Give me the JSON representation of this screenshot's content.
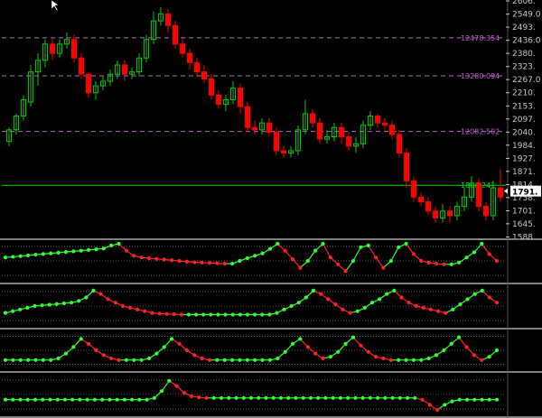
{
  "colors": {
    "background": "#000000",
    "up_candle": "#00cc00",
    "down_candle": "#ff0000",
    "axis_text": "#c8c8c8",
    "panel_border": "#ffffff",
    "level_line": "#c060d0",
    "price_line": "#00dd00",
    "osc_up": "#33ff33",
    "osc_down": "#ff2222",
    "dotted": "#aaaaaa"
  },
  "chart_data": [
    {
      "type": "candlestick",
      "title": "",
      "ylim": [
        1590,
        2610
      ],
      "y_ticks": [
        "2606.",
        "2549.0",
        "2493.",
        "2436.0",
        "2380.",
        "2323.",
        "2267.0",
        "2210.",
        "2153.",
        "2097.",
        "2040.",
        "1984.",
        "1927.",
        "1871.",
        "1814.",
        "1758.",
        "1701.",
        "1645.",
        "1588."
      ],
      "y_tick_values": [
        2606,
        2549,
        2493,
        2436,
        2380,
        2323,
        2267,
        2210,
        2153,
        2097,
        2040,
        1984,
        1927,
        1871,
        1814,
        1758,
        1701,
        1645,
        1588
      ],
      "levels": [
        {
          "value": 2447,
          "label": "12478.354",
          "style": "dash"
        },
        {
          "value": 2283,
          "label": "13280.094",
          "style": "dash"
        },
        {
          "value": 2043,
          "label": "12082.502",
          "style": "dash"
        },
        {
          "value": 1811,
          "label": "1806.241",
          "style": "solid"
        }
      ],
      "current_price": {
        "value": 1786,
        "label": "1791."
      },
      "candles": [
        [
          2000,
          2050,
          1980,
          2060
        ],
        [
          2050,
          2110,
          2030,
          2120
        ],
        [
          2110,
          2180,
          2090,
          2200
        ],
        [
          2170,
          2300,
          2150,
          2330
        ],
        [
          2300,
          2350,
          2240,
          2380
        ],
        [
          2350,
          2420,
          2320,
          2440
        ],
        [
          2420,
          2380,
          2350,
          2450
        ],
        [
          2380,
          2420,
          2360,
          2440
        ],
        [
          2420,
          2440,
          2400,
          2470
        ],
        [
          2440,
          2360,
          2340,
          2460
        ],
        [
          2360,
          2290,
          2270,
          2380
        ],
        [
          2290,
          2210,
          2190,
          2300
        ],
        [
          2210,
          2240,
          2180,
          2260
        ],
        [
          2240,
          2260,
          2220,
          2280
        ],
        [
          2260,
          2290,
          2240,
          2310
        ],
        [
          2290,
          2330,
          2270,
          2350
        ],
        [
          2330,
          2290,
          2260,
          2350
        ],
        [
          2290,
          2300,
          2270,
          2320
        ],
        [
          2300,
          2360,
          2280,
          2380
        ],
        [
          2360,
          2440,
          2340,
          2460
        ],
        [
          2440,
          2520,
          2420,
          2560
        ],
        [
          2520,
          2550,
          2500,
          2580
        ],
        [
          2550,
          2500,
          2470,
          2570
        ],
        [
          2500,
          2420,
          2400,
          2520
        ],
        [
          2420,
          2380,
          2360,
          2440
        ],
        [
          2380,
          2340,
          2310,
          2400
        ],
        [
          2340,
          2300,
          2280,
          2360
        ],
        [
          2300,
          2270,
          2250,
          2330
        ],
        [
          2270,
          2200,
          2180,
          2290
        ],
        [
          2200,
          2160,
          2140,
          2220
        ],
        [
          2160,
          2180,
          2130,
          2200
        ],
        [
          2180,
          2230,
          2160,
          2260
        ],
        [
          2230,
          2150,
          2120,
          2250
        ],
        [
          2150,
          2060,
          2040,
          2170
        ],
        [
          2060,
          2050,
          2030,
          2090
        ],
        [
          2050,
          2080,
          2030,
          2100
        ],
        [
          2080,
          2040,
          2020,
          2100
        ],
        [
          2040,
          1960,
          1940,
          2060
        ],
        [
          1960,
          1950,
          1930,
          1980
        ],
        [
          1950,
          1960,
          1930,
          1980
        ],
        [
          1960,
          2050,
          1940,
          2070
        ],
        [
          2050,
          2120,
          2030,
          2180
        ],
        [
          2120,
          2080,
          2060,
          2140
        ],
        [
          2080,
          2010,
          1990,
          2100
        ],
        [
          2010,
          2020,
          1990,
          2050
        ],
        [
          2020,
          2060,
          2000,
          2080
        ],
        [
          2060,
          2020,
          1990,
          2080
        ],
        [
          2020,
          1980,
          1960,
          2040
        ],
        [
          1980,
          1990,
          1950,
          2020
        ],
        [
          1990,
          2070,
          1970,
          2090
        ],
        [
          2070,
          2110,
          2050,
          2130
        ],
        [
          2110,
          2080,
          2060,
          2120
        ],
        [
          2080,
          2070,
          2050,
          2100
        ],
        [
          2070,
          2030,
          2010,
          2090
        ],
        [
          2030,
          1950,
          1930,
          2050
        ],
        [
          1950,
          1830,
          1800,
          1970
        ],
        [
          1830,
          1760,
          1740,
          1850
        ],
        [
          1760,
          1740,
          1720,
          1780
        ],
        [
          1740,
          1700,
          1680,
          1760
        ],
        [
          1700,
          1670,
          1650,
          1720
        ],
        [
          1670,
          1700,
          1650,
          1730
        ],
        [
          1700,
          1680,
          1650,
          1720
        ],
        [
          1680,
          1720,
          1660,
          1740
        ],
        [
          1720,
          1760,
          1700,
          1800
        ],
        [
          1760,
          1820,
          1740,
          1850
        ],
        [
          1820,
          1720,
          1700,
          1840
        ],
        [
          1720,
          1680,
          1660,
          1740
        ],
        [
          1680,
          1800,
          1660,
          1830
        ],
        [
          1800,
          1760,
          1740,
          1880
        ]
      ]
    },
    {
      "type": "line",
      "title": "",
      "series": [
        {
          "values": [
            0.6,
            0.62,
            0.64,
            0.66,
            0.68,
            0.7,
            0.72,
            0.74,
            0.76,
            0.78,
            0.8,
            0.82,
            0.84,
            0.86,
            0.95,
            1.0,
            0.8,
            0.65,
            0.6,
            0.58,
            0.56,
            0.54,
            0.52,
            0.5,
            0.48,
            0.46,
            0.45,
            0.44,
            0.43,
            0.42,
            0.42,
            0.5,
            0.58,
            0.65,
            0.72,
            0.85,
            1.0,
            0.8,
            0.55,
            0.3,
            0.5,
            0.8,
            1.0,
            0.6,
            0.4,
            0.2,
            0.5,
            0.9,
            0.95,
            0.6,
            0.3,
            0.5,
            0.9,
            1.0,
            0.7,
            0.5,
            0.45,
            0.42,
            0.4,
            0.4,
            0.45,
            0.6,
            0.75,
            1.0,
            0.7,
            0.5
          ],
          "colors": "trend"
        }
      ],
      "ylim": [
        0,
        1
      ]
    },
    {
      "type": "line",
      "title": "",
      "series": [
        {
          "values": [
            0.3,
            0.35,
            0.4,
            0.45,
            0.5,
            0.52,
            0.54,
            0.56,
            0.58,
            0.6,
            0.65,
            0.75,
            0.95,
            0.85,
            0.7,
            0.6,
            0.5,
            0.45,
            0.4,
            0.35,
            0.3,
            0.28,
            0.27,
            0.26,
            0.25,
            0.25,
            0.25,
            0.25,
            0.25,
            0.25,
            0.25,
            0.25,
            0.25,
            0.25,
            0.25,
            0.25,
            0.25,
            0.3,
            0.4,
            0.5,
            0.6,
            0.75,
            0.95,
            0.85,
            0.7,
            0.55,
            0.4,
            0.3,
            0.35,
            0.45,
            0.6,
            0.7,
            0.85,
            0.95,
            0.75,
            0.6,
            0.5,
            0.45,
            0.4,
            0.35,
            0.3,
            0.4,
            0.55,
            0.7,
            0.85,
            0.95,
            0.75,
            0.6
          ],
          "colors": "trend"
        }
      ],
      "ylim": [
        0,
        1
      ]
    },
    {
      "type": "line",
      "title": "",
      "series": [
        {
          "values": [
            0.2,
            0.2,
            0.2,
            0.2,
            0.2,
            0.2,
            0.2,
            0.25,
            0.4,
            0.6,
            0.85,
            0.7,
            0.5,
            0.35,
            0.25,
            0.2,
            0.2,
            0.2,
            0.2,
            0.25,
            0.4,
            0.6,
            0.85,
            0.7,
            0.5,
            0.35,
            0.25,
            0.2,
            0.2,
            0.2,
            0.2,
            0.2,
            0.2,
            0.2,
            0.2,
            0.2,
            0.25,
            0.45,
            0.7,
            0.85,
            0.6,
            0.4,
            0.25,
            0.3,
            0.45,
            0.7,
            0.9,
            0.65,
            0.45,
            0.3,
            0.25,
            0.2,
            0.2,
            0.2,
            0.2,
            0.2,
            0.25,
            0.35,
            0.5,
            0.7,
            0.9,
            0.6,
            0.35,
            0.2,
            0.3,
            0.5
          ],
          "colors": "trend"
        }
      ],
      "ylim": [
        0,
        1
      ]
    },
    {
      "type": "line",
      "title": "",
      "series": [
        {
          "values": [
            0.35,
            0.35,
            0.35,
            0.35,
            0.35,
            0.35,
            0.35,
            0.35,
            0.35,
            0.35,
            0.35,
            0.35,
            0.35,
            0.35,
            0.35,
            0.35,
            0.35,
            0.35,
            0.35,
            0.35,
            0.4,
            0.6,
            0.9,
            0.75,
            0.55,
            0.45,
            0.42,
            0.4,
            0.4,
            0.4,
            0.4,
            0.4,
            0.4,
            0.4,
            0.4,
            0.4,
            0.4,
            0.4,
            0.4,
            0.4,
            0.4,
            0.4,
            0.4,
            0.4,
            0.4,
            0.4,
            0.4,
            0.4,
            0.4,
            0.4,
            0.4,
            0.4,
            0.4,
            0.4,
            0.4,
            0.4,
            0.35,
            0.2,
            0.05,
            0.2,
            0.3,
            0.35,
            0.35,
            0.35,
            0.35,
            0.35,
            0.35
          ],
          "colors": "trend"
        }
      ],
      "ylim": [
        0,
        1
      ]
    }
  ]
}
